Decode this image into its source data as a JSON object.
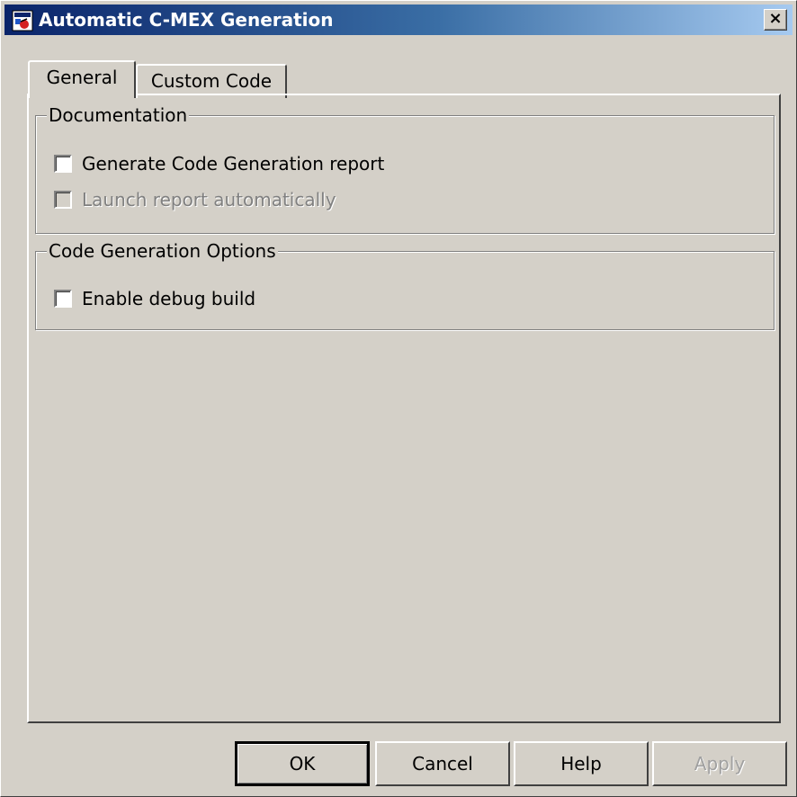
{
  "window": {
    "title": "Automatic C-MEX Generation",
    "close_glyph": "×",
    "icon": "simulink-app-icon"
  },
  "tabs": [
    {
      "label": "General",
      "active": true
    },
    {
      "label": "Custom Code",
      "active": false
    }
  ],
  "documentation": {
    "title": "Documentation",
    "options": [
      {
        "label": "Generate Code Generation report",
        "checked": false,
        "enabled": true
      },
      {
        "label": "Launch report automatically",
        "checked": false,
        "enabled": false
      }
    ]
  },
  "code_generation_options": {
    "title": "Code Generation Options",
    "options": [
      {
        "label": "Enable debug build",
        "checked": false,
        "enabled": true
      }
    ]
  },
  "buttons": {
    "ok": "OK",
    "cancel": "Cancel",
    "help": "Help",
    "apply": "Apply"
  },
  "colors": {
    "title_gradient_start": "#0a246a",
    "title_gradient_end": "#a6caf0",
    "dialog_face": "#d4d0c8",
    "disabled_text": "#808080"
  }
}
